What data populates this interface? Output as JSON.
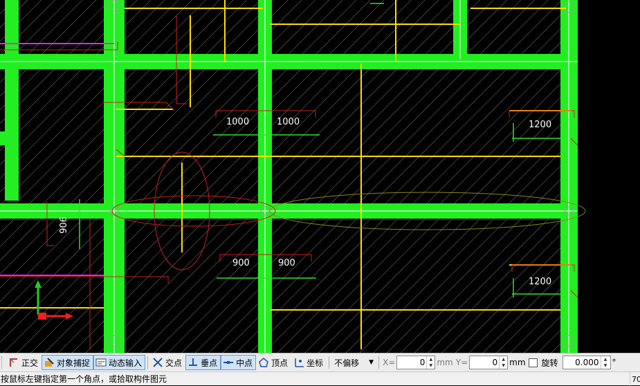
{
  "canvas": {
    "dimensions": [
      {
        "text": "1000"
      },
      {
        "text": "1000"
      },
      {
        "text": "1200"
      },
      {
        "text": "906"
      },
      {
        "text": "900"
      },
      {
        "text": "900"
      },
      {
        "text": "1200"
      }
    ]
  },
  "toolbar": {
    "ortho_label": "正交",
    "snap_label": "对象捕捉",
    "dynamic_input_label": "动态输入",
    "intersection_label": "交点",
    "perpendicular_label": "垂点",
    "midpoint_label": "中点",
    "vertex_label": "顶点",
    "coordinate_label": "坐标",
    "offset_select": "不偏移",
    "x_label": "X=",
    "x_value": "0",
    "x_unit": "mm",
    "y_label": "Y=",
    "y_value": "0",
    "y_unit": "mm",
    "rotate_label": "旋转",
    "rotate_value": "0.000",
    "degree_symbol": "°"
  },
  "status": {
    "prompt": "按鼠标左键指定第一个角点，或拾取构件图元",
    "right_text": "70"
  },
  "colors": {
    "beam": "#22ee22",
    "dimension": "#ffdd00",
    "highlight": "#ff2020",
    "canvas": "#000000",
    "toolbar_active": "#cfe3f7"
  },
  "icons": {
    "ortho": "ortho-icon",
    "snap": "object-snap-icon",
    "dynamic_input": "dynamic-input-icon",
    "intersection": "intersection-icon",
    "perpendicular": "perpendicular-icon",
    "midpoint": "midpoint-icon",
    "vertex": "vertex-icon",
    "coordinate": "coordinate-icon",
    "ucs": "ucs-axis-icon"
  }
}
